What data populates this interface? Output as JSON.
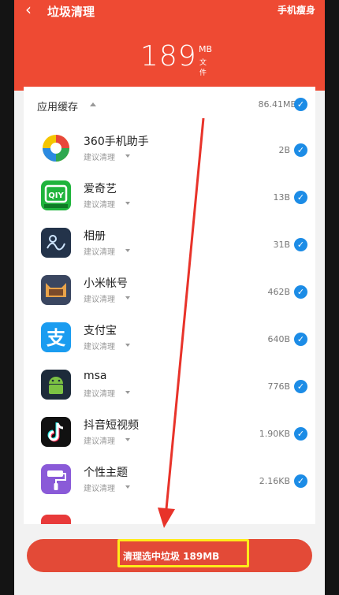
{
  "header": {
    "back_icon": "chevron-left-icon",
    "title": "垃圾清理",
    "action": "手机瘦身",
    "total_size": "189",
    "total_unit": "MB",
    "total_sub": "文件"
  },
  "section": {
    "title": "应用缓存",
    "size": "86.41MB",
    "checked": true
  },
  "apps": [
    {
      "name": "360手机助手",
      "sub": "建议清理",
      "size": "2B",
      "icon": "360-assistant-icon"
    },
    {
      "name": "爱奇艺",
      "sub": "建议清理",
      "size": "13B",
      "icon": "iqiyi-icon"
    },
    {
      "name": "相册",
      "sub": "建议清理",
      "size": "31B",
      "icon": "gallery-icon"
    },
    {
      "name": "小米帐号",
      "sub": "建议清理",
      "size": "462B",
      "icon": "mi-account-icon"
    },
    {
      "name": "支付宝",
      "sub": "建议清理",
      "size": "640B",
      "icon": "alipay-icon"
    },
    {
      "name": "msa",
      "sub": "建议清理",
      "size": "776B",
      "icon": "msa-android-icon"
    },
    {
      "name": "抖音短视频",
      "sub": "建议清理",
      "size": "1.90KB",
      "icon": "douyin-icon"
    },
    {
      "name": "个性主题",
      "sub": "建议清理",
      "size": "2.16KB",
      "icon": "theme-roller-icon"
    }
  ],
  "bottom_button": "清理选中垃圾 189MB",
  "colors": {
    "header": "#ee4a33",
    "check": "#1c8ce6",
    "button": "#e34a37",
    "highlight": "#ffeb1a",
    "arrow": "#e8332a"
  }
}
